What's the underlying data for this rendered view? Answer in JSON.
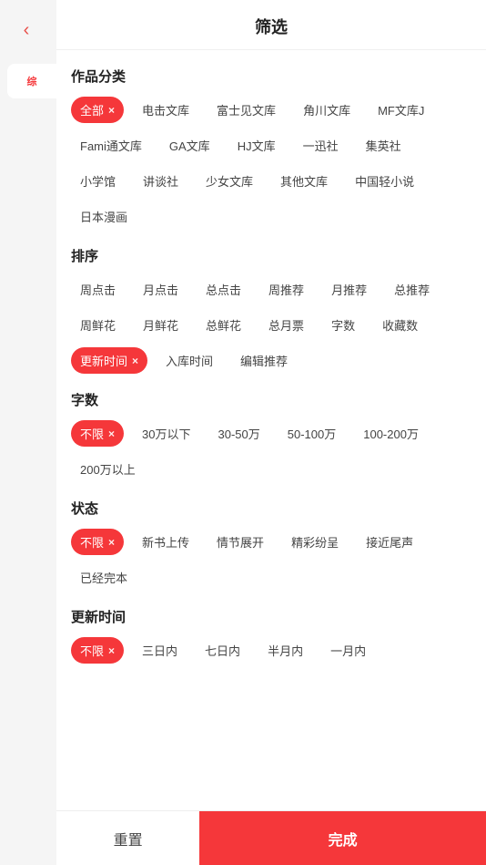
{
  "header": {
    "title": "筛选",
    "back_label": "‹"
  },
  "sections": {
    "category": {
      "title": "作品分类",
      "tags": [
        {
          "label": "全部",
          "active": true
        },
        {
          "label": "电击文库"
        },
        {
          "label": "富士见文库"
        },
        {
          "label": "角川文库"
        },
        {
          "label": "MF文库J"
        },
        {
          "label": "Fami通文库"
        },
        {
          "label": "GA文库"
        },
        {
          "label": "HJ文库"
        },
        {
          "label": "一迅社"
        },
        {
          "label": "集英社"
        },
        {
          "label": "小学馆"
        },
        {
          "label": "讲谈社"
        },
        {
          "label": "少女文库"
        },
        {
          "label": "其他文库"
        },
        {
          "label": "中国轻小说"
        },
        {
          "label": "日本漫画"
        }
      ]
    },
    "sort": {
      "title": "排序",
      "tags": [
        {
          "label": "周点击"
        },
        {
          "label": "月点击"
        },
        {
          "label": "总点击"
        },
        {
          "label": "周推荐"
        },
        {
          "label": "月推荐"
        },
        {
          "label": "总推荐"
        },
        {
          "label": "周鲜花"
        },
        {
          "label": "月鲜花"
        },
        {
          "label": "总鲜花"
        },
        {
          "label": "总月票"
        },
        {
          "label": "字数"
        },
        {
          "label": "收藏数"
        },
        {
          "label": "更新时间",
          "active": true
        },
        {
          "label": "入库时间"
        },
        {
          "label": "编辑推荐"
        }
      ]
    },
    "wordcount": {
      "title": "字数",
      "tags": [
        {
          "label": "不限",
          "active": true
        },
        {
          "label": "30万以下"
        },
        {
          "label": "30-50万"
        },
        {
          "label": "50-100万"
        },
        {
          "label": "100-200万"
        },
        {
          "label": "200万以上"
        }
      ]
    },
    "status": {
      "title": "状态",
      "tags": [
        {
          "label": "不限",
          "active": true
        },
        {
          "label": "新书上传"
        },
        {
          "label": "情节展开"
        },
        {
          "label": "精彩纷呈"
        },
        {
          "label": "接近尾声"
        },
        {
          "label": "已经完本"
        }
      ]
    },
    "update_time": {
      "title": "更新时间",
      "tags": [
        {
          "label": "不限",
          "active": true
        },
        {
          "label": "三日内"
        },
        {
          "label": "七日内"
        },
        {
          "label": "半月内"
        },
        {
          "label": "一月内"
        }
      ]
    }
  },
  "footer": {
    "reset_label": "重置",
    "done_label": "完成"
  },
  "sidebar": {
    "pill_label": "综"
  }
}
